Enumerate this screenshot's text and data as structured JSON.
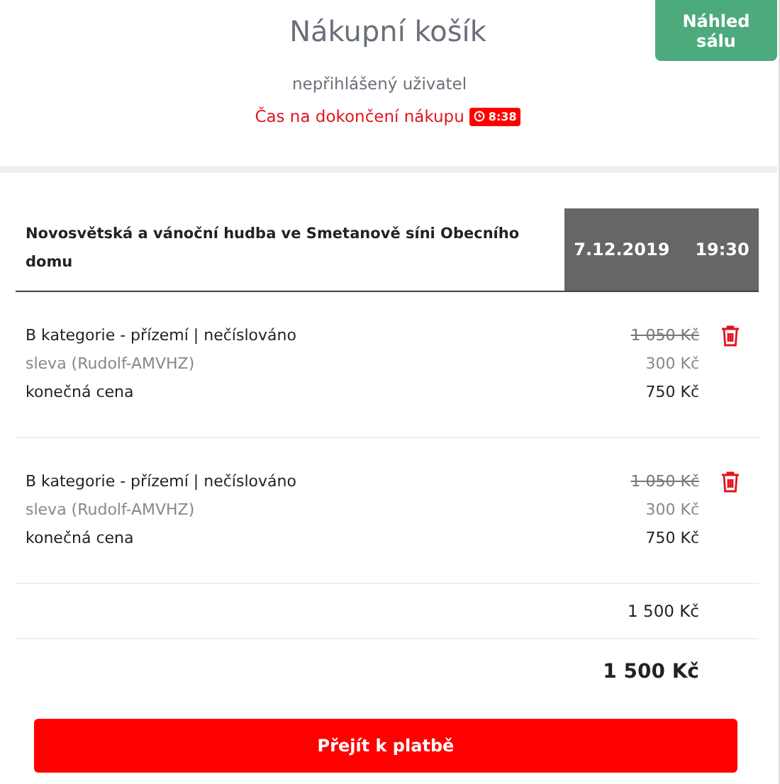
{
  "header": {
    "title": "Nákupní košík",
    "preview_button": "Náhled sálu",
    "user": "nepřihlášený uživatel",
    "timer_label": "Čas na dokončení nákupu",
    "timer": "8:38"
  },
  "event": {
    "title": "Novosvětská a vánoční hudba ve Smetanově síni Obecního domu",
    "date": "7.12.2019",
    "time": "19:30"
  },
  "tickets": [
    {
      "name": "B kategorie - přízemí | nečíslováno",
      "original_price": "1 050 Kč",
      "discount_label": "sleva (Rudolf-AMVHZ)",
      "discount": "300 Kč",
      "final_label": "konečná cena",
      "final_price": "750 Kč"
    },
    {
      "name": "B kategorie - přízemí | nečíslováno",
      "original_price": "1 050 Kč",
      "discount_label": "sleva (Rudolf-AMVHZ)",
      "discount": "300 Kč",
      "final_label": "konečná cena",
      "final_price": "750 Kč"
    }
  ],
  "subtotal": "1 500 Kč",
  "total": "1 500 Kč",
  "pay_button": "Přejít k platbě"
}
